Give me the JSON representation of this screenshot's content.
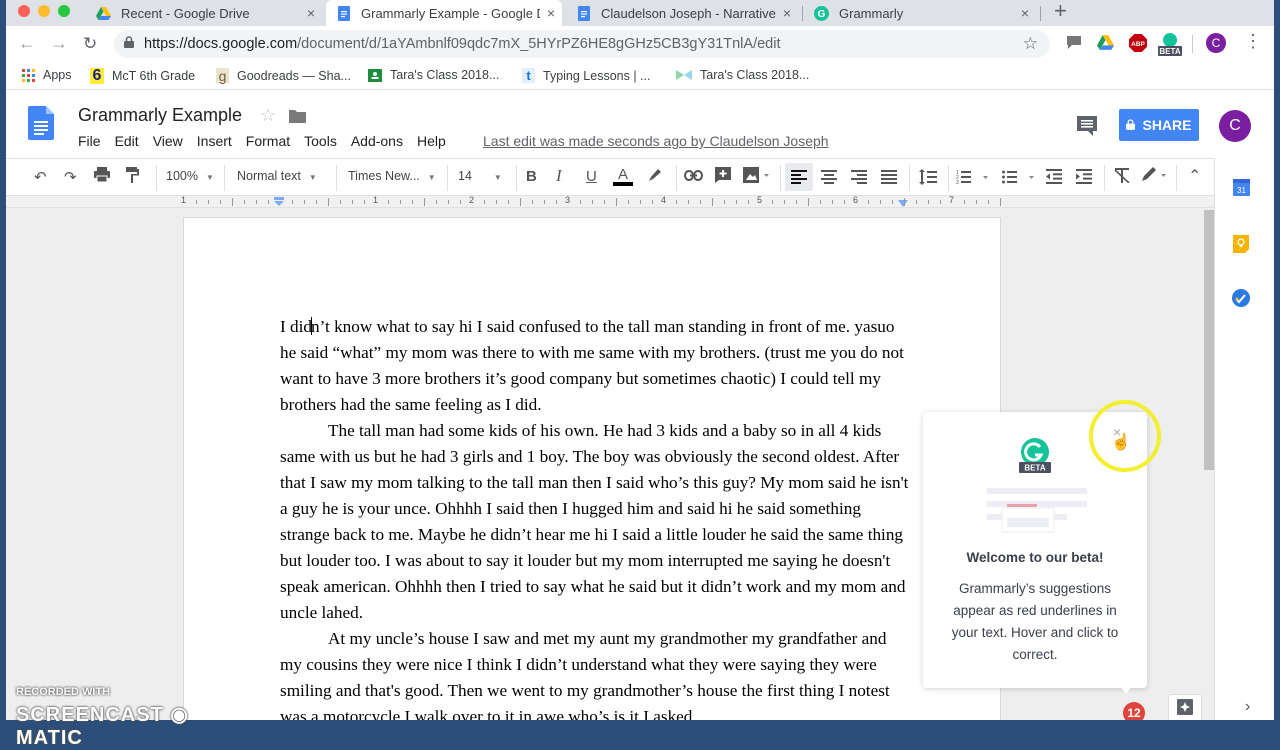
{
  "browser": {
    "tabs": [
      {
        "label": "Recent - Google Drive",
        "icon": "google-drive-icon",
        "active": false
      },
      {
        "label": "Grammarly Example - Google D",
        "icon": "google-docs-icon",
        "active": true
      },
      {
        "label": "Claudelson Joseph - Narrative",
        "icon": "google-docs-icon",
        "active": false
      },
      {
        "label": "Grammarly",
        "icon": "grammarly-icon",
        "active": false
      }
    ],
    "close_glyph": "×",
    "new_tab_glyph": "+",
    "url_domain": "https://docs.google.com",
    "url_path": "/document/d/1aYAmbnlf09qdc7mX_5HYrPZ6HE8gGHz5CB3gY31TnlA/edit",
    "extensions": [
      "comment-extension-icon",
      "google-drive-icon",
      "adblock-plus-icon",
      "grammarly-beta-icon"
    ],
    "extension_labels": {
      "abp": "ABP",
      "beta": "BETA"
    },
    "profile_initial": "C",
    "bookmarks": [
      {
        "label": "Apps",
        "icon": "apps-grid-icon"
      },
      {
        "label": "McT 6th Grade",
        "icon": "six-icon",
        "glyph": "6"
      },
      {
        "label": "Goodreads — Sha...",
        "icon": "goodreads-icon",
        "glyph": "g"
      },
      {
        "label": "Tara's Class 2018...",
        "icon": "google-classroom-icon"
      },
      {
        "label": "Typing Lessons | ...",
        "icon": "typing-icon",
        "glyph": "t"
      },
      {
        "label": "Tara's Class 2018...",
        "icon": "bow-icon"
      }
    ]
  },
  "docs": {
    "title": "Grammarly Example",
    "menu": [
      "File",
      "Edit",
      "View",
      "Insert",
      "Format",
      "Tools",
      "Add-ons",
      "Help"
    ],
    "last_edit": "Last edit was made seconds ago by Claudelson Joseph",
    "share_label": "SHARE",
    "avatar_initial": "C",
    "toolbar": {
      "zoom": "100%",
      "style": "Normal text",
      "font": "Times New...",
      "size": "14"
    },
    "ruler_numbers": [
      "1",
      "1",
      "2",
      "3",
      "4",
      "5",
      "6",
      "7"
    ],
    "paragraphs": [
      {
        "indent": false,
        "pre": "I did",
        "post": "n’t know what to say hi I said confused to the tall man standing in front of me. yasuo he said “what” my mom was there to with me same with my brothers. (trust me you do not want to have 3 more brothers it’s good company but sometimes chaotic) I could tell my brothers had the same feeling as I did."
      },
      {
        "indent": true,
        "text": "The tall man had some kids of his own. He had 3 kids and a baby so in all 4 kids same with us but he had 3 girls and 1 boy. The boy was obviously the second oldest. After that I saw my mom talking to the tall man then I said who’s this guy? My mom said he isn't a guy he is your unce. Ohhhh I said then I hugged him and said hi he said something strange back to me. Maybe he didn’t hear me hi I said a little louder he said the same thing but louder too. I was about to say it louder but my mom interrupted me saying he doesn't speak american. Ohhhh then I tried to say what he said but it didn’t work and my mom and uncle lahed."
      },
      {
        "indent": true,
        "text": "At my uncle’s house I saw and met my aunt my grandmother my grandfather and my cousins they were nice I think I didn’t understand what they were saying they were smiling and that's good. Then we went to my grandmother’s house the first thing I notest was a motorcycle I walk over to it in awe who’s is it I asked"
      }
    ]
  },
  "grammarly": {
    "badge_label": "BETA",
    "title": "Welcome to our beta!",
    "body": "Grammarly’s suggestions appear as red underlines in your text. Hover and click to correct.",
    "close_glyph": "×",
    "issue_count": "12",
    "brand_color": "#15c39a"
  },
  "side_panel": [
    "calendar-icon",
    "keep-icon",
    "tasks-icon"
  ],
  "calendar_day": "31",
  "watermark": {
    "line1": "RECORDED WITH",
    "line2": "SCREENCAST ◉ MATIC"
  }
}
